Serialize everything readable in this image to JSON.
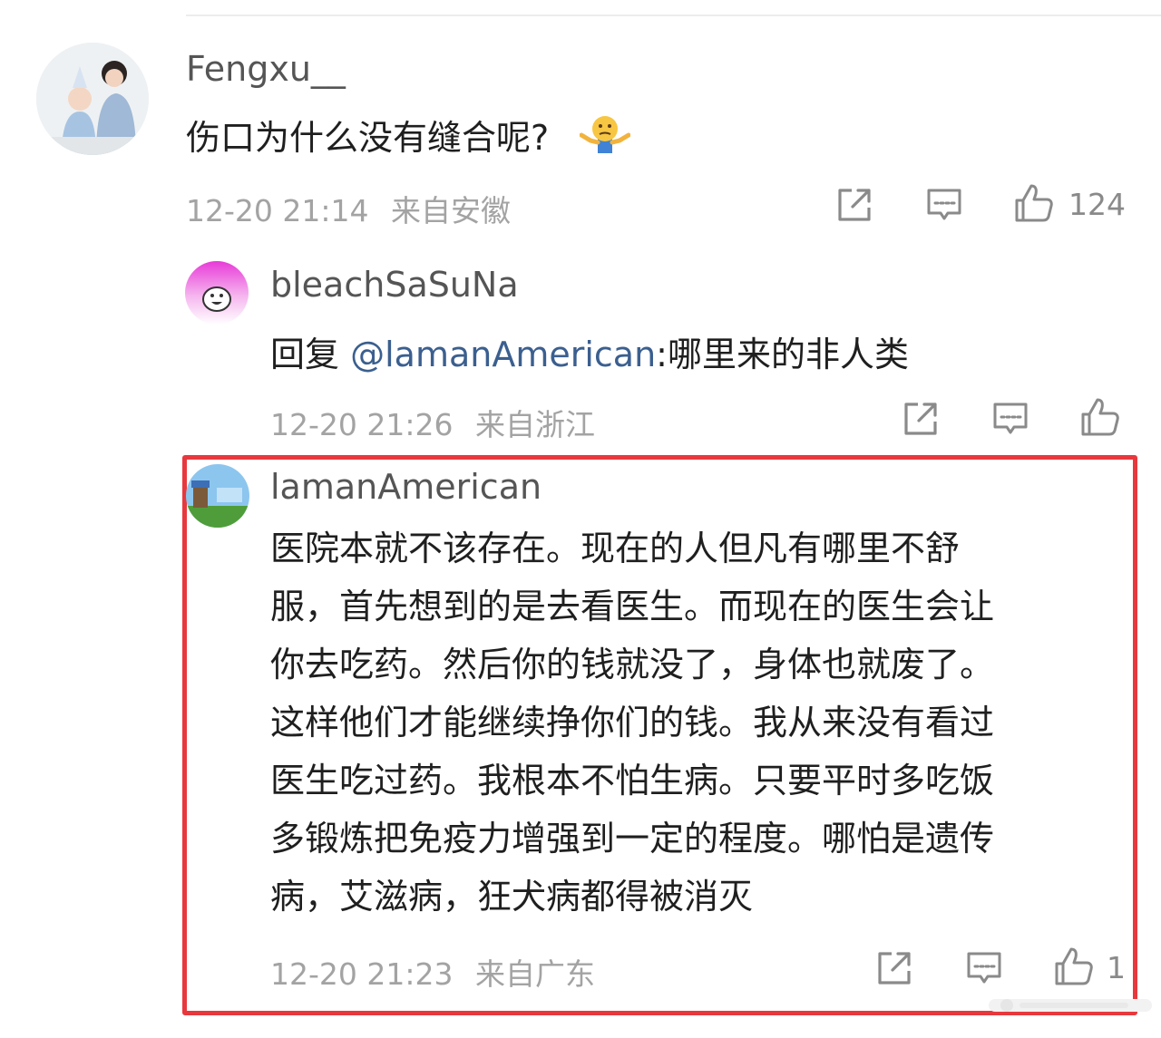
{
  "comments": [
    {
      "username": "Fengxu__",
      "text": "伤口为什么没有缝合呢?",
      "emoji": "shrug-icon",
      "time": "12-20 21:14",
      "location": "来自安徽",
      "likes": "124"
    },
    {
      "username": "bleachSaSuNa",
      "reply_prefix": "回复 ",
      "mention": "@lamanAmerican",
      "reply_text": ":哪里来的非人类",
      "time": "12-20 21:26",
      "location": "来自浙江"
    },
    {
      "username": "lamanAmerican",
      "lines": [
        "医院本就不该存在。现在的人但凡有哪里不舒",
        "服，首先想到的是去看医生。而现在的医生会让",
        "你去吃药。然后你的钱就没了，身体也就废了。",
        "这样他们才能继续挣你们的钱。我从来没有看过",
        "医生吃过药。我根本不怕生病。只要平时多吃饭",
        "多锻炼把免疫力增强到一定的程度。哪怕是遗传",
        "病，艾滋病，狂犬病都得被消灭"
      ],
      "time": "12-20 21:23",
      "location": "来自广东",
      "likes": "1"
    }
  ],
  "colors": {
    "highlight_border": "#e8383d",
    "mention": "#3b5f8f",
    "meta": "#a3a3a3"
  },
  "icons": [
    "share-icon",
    "comment-icon",
    "thumbs-up-icon"
  ]
}
